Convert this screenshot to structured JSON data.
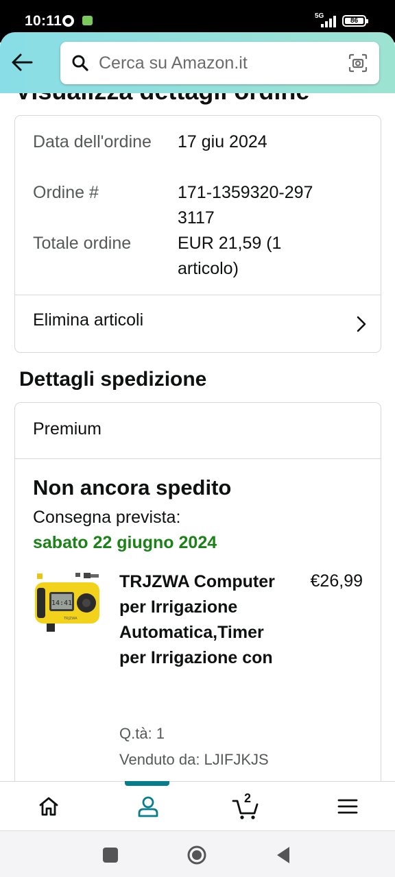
{
  "status_bar": {
    "time": "10:11",
    "network": "5G",
    "battery": "86"
  },
  "header": {
    "search_placeholder": "Cerca su Amazon.it"
  },
  "page": {
    "heading": "Visualizza dettagli ordine"
  },
  "order_summary": {
    "date_label": "Data dell'ordine",
    "date_value": "17 giu 2024",
    "number_label": "Ordine #",
    "number_value": "171-1359320-2973117",
    "total_label": "Totale ordine",
    "total_value": "EUR 21,59 (1 articolo)",
    "remove_items_label": "Elimina articoli"
  },
  "shipping": {
    "section_title": "Dettagli spedizione",
    "method": "Premium",
    "status": "Non ancora spedito",
    "delivery_label": "Consegna prevista:",
    "delivery_date": "sabato 22 giugno 2024",
    "delivery_date_color": "#1a8217",
    "item": {
      "title": "TRJZWA Computer per Irrigazione Automatica,Timer per Irrigazione con",
      "price": "€26,99",
      "quantity": "Q.tà: 1",
      "seller": "Venduto da: LJIFJKJS",
      "thumbnail_color": "#f2d21b"
    }
  },
  "bottom_nav": {
    "items": [
      {
        "icon": "home-icon"
      },
      {
        "icon": "account-icon",
        "active": true
      },
      {
        "icon": "cart-icon",
        "count": "2"
      },
      {
        "icon": "menu-icon"
      }
    ],
    "active_color": "#067d8c"
  },
  "system_nav": [
    "recents-button",
    "home-button",
    "back-button"
  ]
}
